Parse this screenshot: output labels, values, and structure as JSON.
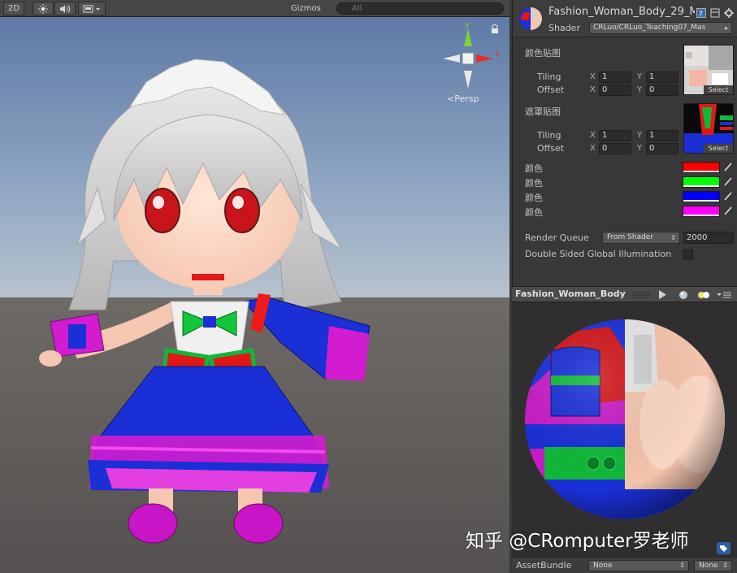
{
  "scene": {
    "toolbar": {
      "mode_2d": "2D",
      "gizmos": "Gizmos",
      "search_placeholder": "All"
    },
    "persp_label": "<Persp",
    "axis_labels": {
      "y": "y",
      "x": "x"
    },
    "colors": {
      "sky": "#8aa2bf",
      "ground": "#5b5855"
    }
  },
  "inspector": {
    "material_name": "Fashion_Woman_Body_29_M",
    "shader_label": "Shader",
    "shader_value": "CRLuo/CRLuo_Teaching07_Mas",
    "main_texture": {
      "label": "颜色贴图",
      "tiling_label": "Tiling",
      "offset_label": "Offset",
      "tiling_x": "1",
      "tiling_y": "1",
      "offset_x": "0",
      "offset_y": "0",
      "select_label": "Select"
    },
    "mask_texture": {
      "label": "遮罩贴图",
      "tiling_label": "Tiling",
      "offset_label": "Offset",
      "tiling_x": "1",
      "tiling_y": "1",
      "offset_x": "0",
      "offset_y": "0",
      "select_label": "Select"
    },
    "axis_x": "X",
    "axis_y": "Y",
    "colors": [
      {
        "label": "颜色",
        "value": "#ff0000"
      },
      {
        "label": "颜色",
        "value": "#00ff00"
      },
      {
        "label": "颜色",
        "value": "#0000ff"
      },
      {
        "label": "颜色",
        "value": "#ff00ff"
      }
    ],
    "render_queue_label": "Render Queue",
    "render_queue_mode": "From Shader",
    "render_queue_value": "2000",
    "dsgi_label": "Double Sided Global Illumination",
    "dsgi_checked": false
  },
  "preview": {
    "title": "Fashion_Woman_Body",
    "watermark": "知乎 @CRomputer罗老师",
    "assetbundle_label": "AssetBundle",
    "assetbundle_value": "None",
    "assetbundle_variant": "None"
  }
}
